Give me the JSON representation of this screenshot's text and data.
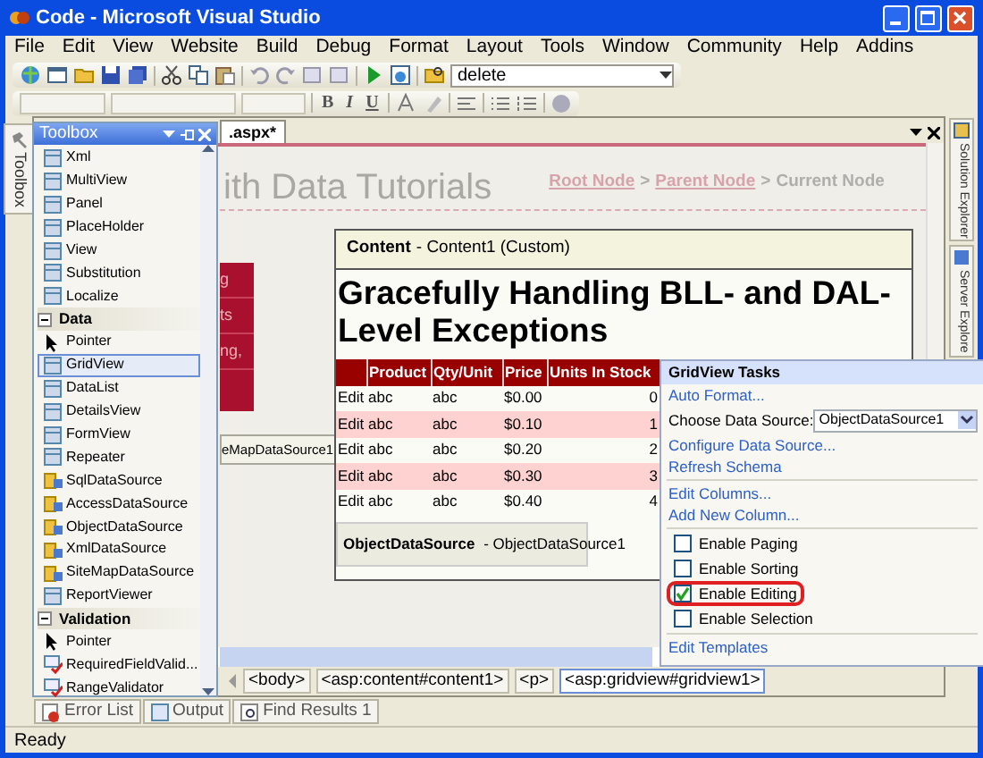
{
  "window": {
    "title": "Code - Microsoft Visual Studio"
  },
  "menu": [
    "File",
    "Edit",
    "View",
    "Website",
    "Build",
    "Debug",
    "Format",
    "Layout",
    "Tools",
    "Window",
    "Community",
    "Help",
    "Addins"
  ],
  "toolbar": {
    "find_box": "delete"
  },
  "format_toolbar": {
    "buttons": [
      "B",
      "I",
      "U"
    ]
  },
  "left_dock": [
    "Toolbox"
  ],
  "toolbox": {
    "title": "Toolbox",
    "items": [
      {
        "label": "Xml",
        "kind": "control",
        "selected": false
      },
      {
        "label": "MultiView",
        "kind": "control",
        "selected": false
      },
      {
        "label": "Panel",
        "kind": "control",
        "selected": false
      },
      {
        "label": "PlaceHolder",
        "kind": "control",
        "selected": false
      },
      {
        "label": "View",
        "kind": "control",
        "selected": false
      },
      {
        "label": "Substitution",
        "kind": "control",
        "selected": false
      },
      {
        "label": "Localize",
        "kind": "control",
        "selected": false
      }
    ],
    "groups": [
      {
        "label": "Data",
        "expanded": true,
        "items": [
          {
            "label": "Pointer",
            "kind": "pointer",
            "selected": false
          },
          {
            "label": "GridView",
            "kind": "control",
            "selected": true
          },
          {
            "label": "DataList",
            "kind": "control",
            "selected": false
          },
          {
            "label": "DetailsView",
            "kind": "control",
            "selected": false
          },
          {
            "label": "FormView",
            "kind": "control",
            "selected": false
          },
          {
            "label": "Repeater",
            "kind": "control",
            "selected": false
          },
          {
            "label": "SqlDataSource",
            "kind": "source",
            "selected": false
          },
          {
            "label": "AccessDataSource",
            "kind": "source",
            "selected": false
          },
          {
            "label": "ObjectDataSource",
            "kind": "source",
            "selected": false
          },
          {
            "label": "XmlDataSource",
            "kind": "source",
            "selected": false
          },
          {
            "label": "SiteMapDataSource",
            "kind": "source",
            "selected": false
          },
          {
            "label": "ReportViewer",
            "kind": "control",
            "selected": false
          }
        ]
      },
      {
        "label": "Validation",
        "expanded": true,
        "items": [
          {
            "label": "Pointer",
            "kind": "pointer",
            "selected": false
          },
          {
            "label": "RequiredFieldValid...",
            "kind": "validator",
            "selected": false
          },
          {
            "label": "RangeValidator",
            "kind": "validator",
            "selected": false
          }
        ]
      }
    ]
  },
  "document_tab": ".aspx*",
  "design": {
    "site_title": "ith Data Tutorials",
    "breadcrumb": [
      {
        "text": "Root Node",
        "kind": "link"
      },
      {
        "text": ">",
        "kind": "separator"
      },
      {
        "text": "Parent Node",
        "kind": "link"
      },
      {
        "text": ">",
        "kind": "separator"
      },
      {
        "text": "Current Node",
        "kind": "current"
      }
    ],
    "sidebar_fragments": [
      "g",
      "ts",
      "ng,"
    ],
    "sitemap_source": "eMapDataSource1"
  },
  "content": {
    "label": "Content",
    "detail": "- Content1 (Custom)",
    "heading": "Gracefully Handling BLL- and DAL-Level Exceptions"
  },
  "grid": {
    "columns": [
      "Product",
      "Qty/Unit",
      "Price",
      "Units In Stock"
    ],
    "rows": [
      {
        "action": "Edit",
        "cells": [
          "abc",
          "abc",
          "$0.00",
          "0"
        ]
      },
      {
        "action": "Edit",
        "cells": [
          "abc",
          "abc",
          "$0.10",
          "1"
        ]
      },
      {
        "action": "Edit",
        "cells": [
          "abc",
          "abc",
          "$0.20",
          "2"
        ]
      },
      {
        "action": "Edit",
        "cells": [
          "abc",
          "abc",
          "$0.30",
          "3"
        ]
      },
      {
        "action": "Edit",
        "cells": [
          "abc",
          "abc",
          "$0.40",
          "4"
        ]
      }
    ]
  },
  "data_source": {
    "label": "ObjectDataSource",
    "detail": "- ObjectDataSource1"
  },
  "tasks": {
    "title": "GridView Tasks",
    "items": [
      {
        "kind": "link",
        "text": "Auto Format..."
      },
      {
        "kind": "select",
        "label": "Choose Data Source:",
        "value": "ObjectDataSource1"
      },
      {
        "kind": "link",
        "text": "Configure Data Source..."
      },
      {
        "kind": "link",
        "text": "Refresh Schema"
      },
      {
        "kind": "divider"
      },
      {
        "kind": "link",
        "text": "Edit Columns..."
      },
      {
        "kind": "link",
        "text": "Add New Column..."
      },
      {
        "kind": "divider"
      },
      {
        "kind": "checkbox",
        "text": "Enable Paging",
        "checked": false,
        "highlighted": false
      },
      {
        "kind": "checkbox",
        "text": "Enable Sorting",
        "checked": false,
        "highlighted": false
      },
      {
        "kind": "checkbox",
        "text": "Enable Editing",
        "checked": true,
        "highlighted": true
      },
      {
        "kind": "checkbox",
        "text": "Enable Selection",
        "checked": false,
        "highlighted": false
      },
      {
        "kind": "divider"
      },
      {
        "kind": "link",
        "text": "Edit Templates"
      }
    ]
  },
  "tag_bar": [
    {
      "text": "<body>",
      "selected": false
    },
    {
      "text": "<asp:content#content1>",
      "selected": false
    },
    {
      "text": "<p>",
      "selected": false
    },
    {
      "text": "<asp:gridview#gridview1>",
      "selected": true
    }
  ],
  "right_dock": [
    "Solution Explorer",
    "Server Explore"
  ],
  "bottom_tabs": [
    "Error List",
    "Output",
    "Find Results 1"
  ],
  "status_bar": "Ready"
}
